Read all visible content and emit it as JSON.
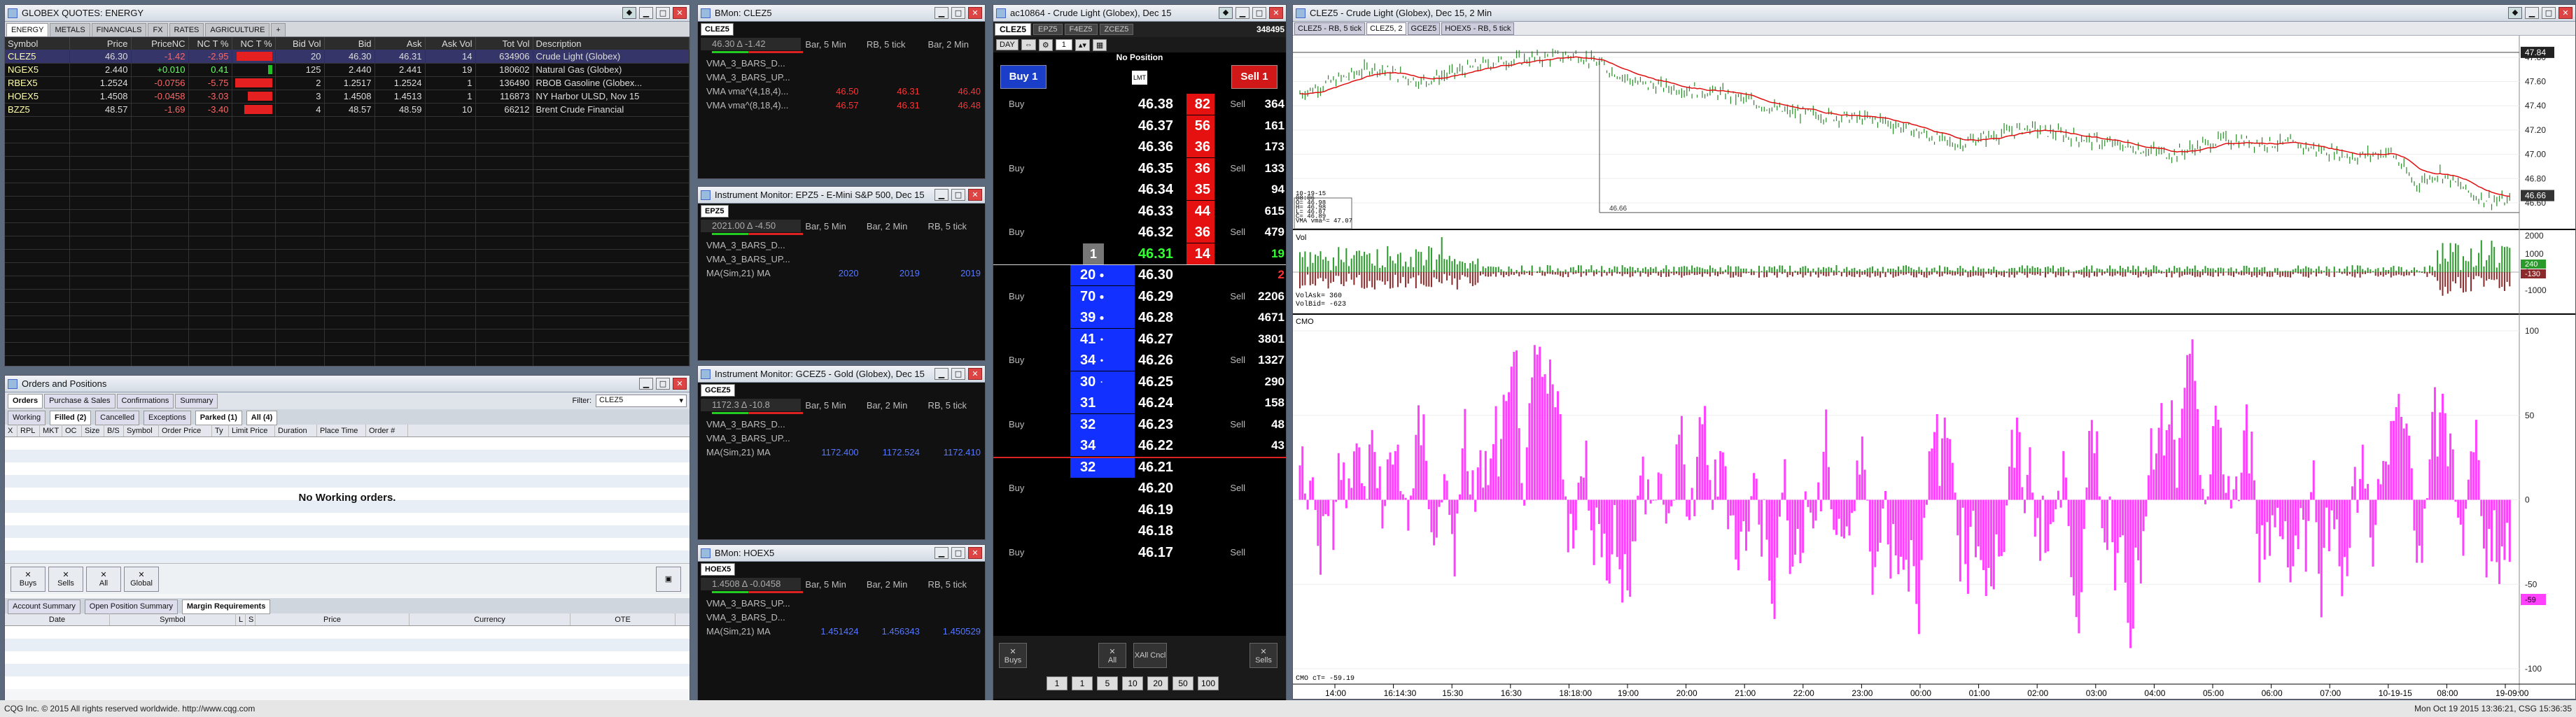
{
  "quotes": {
    "title": "GLOBEX QUOTES: ENERGY",
    "tabs": [
      "ENERGY",
      "METALS",
      "FINANCIALS",
      "FX",
      "RATES",
      "AGRICULTURE",
      "+"
    ],
    "columns": [
      "Symbol",
      "Price",
      "PriceNC",
      "NC T %",
      "NC T %",
      "Bid Vol",
      "Bid",
      "Ask",
      "Ask Vol",
      "Tot Vol",
      "Description"
    ],
    "rows": [
      {
        "sym": "CLEZ5",
        "price": "46.30",
        "nc": "-1.42",
        "pct": "-2.95",
        "bidvol": "20",
        "bid": "46.30",
        "ask": "46.31",
        "askvol": "14",
        "tot": "634906",
        "desc": "Crude Light (Globex)",
        "bar": 0.95,
        "dir": "neg"
      },
      {
        "sym": "NGEX5",
        "price": "2.440",
        "nc": "+0.010",
        "pct": "0.41",
        "bidvol": "125",
        "bid": "2.440",
        "ask": "2.441",
        "askvol": "19",
        "tot": "180602",
        "desc": "Natural Gas (Globex)",
        "bar": 0.1,
        "dir": "pos"
      },
      {
        "sym": "RBEX5",
        "price": "1.2524",
        "nc": "-0.0756",
        "pct": "-5.75",
        "bidvol": "2",
        "bid": "1.2517",
        "ask": "1.2524",
        "askvol": "1",
        "tot": "136490",
        "desc": "RBOB Gasoline (Globex...",
        "bar": 1.0,
        "dir": "neg"
      },
      {
        "sym": "HOEX5",
        "price": "1.4508",
        "nc": "-0.0458",
        "pct": "-3.03",
        "bidvol": "3",
        "bid": "1.4508",
        "ask": "1.4513",
        "askvol": "1",
        "tot": "116873",
        "desc": "NY Harbor ULSD, Nov 15",
        "bar": 0.65,
        "dir": "neg"
      },
      {
        "sym": "BZZ5",
        "price": "48.57",
        "nc": "-1.69",
        "pct": "-3.40",
        "bidvol": "4",
        "bid": "48.57",
        "ask": "48.59",
        "askvol": "10",
        "tot": "66212",
        "desc": "Brent Crude Financial",
        "bar": 0.75,
        "dir": "neg"
      }
    ]
  },
  "orders": {
    "title": "Orders and Positions",
    "tabs": [
      "Orders",
      "Purchase & Sales",
      "Confirmations",
      "Summary"
    ],
    "filter_label": "Filter:",
    "filter_value": "CLEZ5",
    "subtabs": [
      "Working",
      "Filled (2)",
      "Cancelled",
      "Exceptions",
      "Parked (1)",
      "All (4)"
    ],
    "columns": [
      "X",
      "RPL",
      "MKT",
      "OC",
      "Size",
      "B/S",
      "Symbol",
      "Order Price",
      "Ty",
      "Limit Price",
      "Duration",
      "Place Time",
      "Order #"
    ],
    "empty_text": "No Working orders.",
    "buttons": [
      "Buys",
      "Sells",
      "All",
      "Global"
    ],
    "bottom_tabs": [
      "Account Summary",
      "Open Position Summary",
      "Margin Requirements"
    ],
    "bottom_columns": [
      "Date",
      "Symbol",
      "L",
      "S",
      "Price",
      "Currency",
      "OTE"
    ]
  },
  "monitors": [
    {
      "title": "BMon: CLEZ5",
      "sym": "CLEZ5",
      "last": "46.30 Δ -1.42",
      "cols": [
        "Bar, 5 Min",
        "RB, 5 tick",
        "Bar, 2 Min"
      ],
      "rows": [
        {
          "label": "VMA_3_BARS_D...",
          "vals": [
            "",
            "",
            ""
          ]
        },
        {
          "label": "VMA_3_BARS_UP...",
          "vals": [
            "",
            "",
            ""
          ]
        },
        {
          "label": "VMA vma^(4,18,4)...",
          "vals": [
            "46.50",
            "46.31",
            "46.40"
          ],
          "color": "red"
        },
        {
          "label": "VMA vma^(8,18,4)...",
          "vals": [
            "46.57",
            "46.31",
            "46.48"
          ],
          "color": "red"
        }
      ]
    },
    {
      "title": "Instrument Monitor: EPZ5 - E-Mini S&P 500, Dec 15",
      "sym": "EPZ5",
      "last": "2021.00 Δ -4.50",
      "cols": [
        "Bar, 5 Min",
        "Bar, 2 Min",
        "RB, 5 tick"
      ],
      "rows": [
        {
          "label": "VMA_3_BARS_D...",
          "vals": [
            "",
            "",
            ""
          ]
        },
        {
          "label": "VMA_3_BARS_UP...",
          "vals": [
            "",
            "",
            ""
          ]
        },
        {
          "label": "MA(Sim,21) MA",
          "vals": [
            "2020",
            "2019",
            "2019"
          ],
          "color": "blue"
        }
      ]
    },
    {
      "title": "Instrument Monitor: GCEZ5 - Gold (Globex), Dec 15",
      "sym": "GCEZ5",
      "last": "1172.3 Δ -10.8",
      "cols": [
        "Bar, 5 Min",
        "Bar, 2 Min",
        "RB, 5 tick"
      ],
      "rows": [
        {
          "label": "VMA_3_BARS_D...",
          "vals": [
            "",
            "",
            ""
          ]
        },
        {
          "label": "VMA_3_BARS_UP...",
          "vals": [
            "",
            "",
            ""
          ]
        },
        {
          "label": "MA(Sim,21) MA",
          "vals": [
            "1172.400",
            "1172.524",
            "1172.410"
          ],
          "color": "blue"
        }
      ]
    },
    {
      "title": "BMon: HOEX5",
      "sym": "HOEX5",
      "last": "1.4508 Δ -0.0458",
      "cols": [
        "Bar, 5 Min",
        "Bar, 2 Min",
        "RB, 5 tick"
      ],
      "rows": [
        {
          "label": "VMA_3_BARS_UP...",
          "vals": [
            "",
            "",
            ""
          ]
        },
        {
          "label": "VMA_3_BARS_D...",
          "vals": [
            "",
            "",
            ""
          ]
        },
        {
          "label": "MA(Sim,21) MA",
          "vals": [
            "1.451424",
            "1.456343",
            "1.450529"
          ],
          "color": "blue"
        }
      ]
    }
  ],
  "dom": {
    "title": "ac10864 - Crude Light (Globex), Dec 15",
    "tabs": [
      "CLEZ5",
      "EPZ5",
      "F4EZ5",
      "ZCEZ5"
    ],
    "vol_total": "348495",
    "duration": "DAY",
    "qty": "1",
    "no_position": "No Position",
    "buy_label": "Buy 1",
    "sell_label": "Sell 1",
    "lmt": "LMT",
    "rows": [
      {
        "price": "46.38",
        "ask": "82",
        "vol": "364",
        "side": "ask"
      },
      {
        "price": "46.37",
        "ask": "56",
        "vol": "161",
        "side": "ask"
      },
      {
        "price": "46.36",
        "ask": "36",
        "vol": "173",
        "side": "ask"
      },
      {
        "price": "46.35",
        "ask": "36",
        "vol": "133",
        "side": "ask"
      },
      {
        "price": "46.34",
        "ask": "35",
        "vol": "94",
        "side": "ask"
      },
      {
        "price": "46.33",
        "ask": "44",
        "vol": "615",
        "side": "ask"
      },
      {
        "price": "46.32",
        "ask": "36",
        "vol": "479",
        "side": "ask"
      },
      {
        "price": "46.31",
        "ask": "14",
        "vol": "19",
        "side": "ask",
        "last": true,
        "lastsize": "1"
      },
      {
        "price": "46.30",
        "bid": "20",
        "vol": "2",
        "side": "bid",
        "dot": "●"
      },
      {
        "price": "46.29",
        "bid": "70",
        "vol": "2206",
        "side": "bid",
        "dot": "●"
      },
      {
        "price": "46.28",
        "bid": "39",
        "vol": "4671",
        "side": "bid",
        "dot": "●"
      },
      {
        "price": "46.27",
        "bid": "41",
        "vol": "3801",
        "side": "bid",
        "dot": "•"
      },
      {
        "price": "46.26",
        "bid": "34",
        "vol": "1327",
        "side": "bid",
        "dot": "•"
      },
      {
        "price": "46.25",
        "bid": "30",
        "vol": "290",
        "side": "bid",
        "dot": "·"
      },
      {
        "price": "46.24",
        "bid": "31",
        "vol": "158",
        "side": "bid"
      },
      {
        "price": "46.23",
        "bid": "32",
        "vol": "48",
        "side": "bid"
      },
      {
        "price": "46.22",
        "bid": "34",
        "vol": "43",
        "side": "bid"
      },
      {
        "price": "46.21",
        "bid": "32",
        "vol": "",
        "side": "bid"
      },
      {
        "price": "46.20",
        "vol": "",
        "side": "none"
      },
      {
        "price": "46.19",
        "vol": "",
        "side": "none"
      },
      {
        "price": "46.18",
        "vol": "",
        "side": "none"
      },
      {
        "price": "46.17",
        "vol": "",
        "side": "none"
      }
    ],
    "buy_text": "Buy",
    "sell_text": "Sell",
    "bottom_buttons": [
      "Buys",
      "All",
      "XAll Cncl",
      "Sells"
    ],
    "qty_buttons": [
      "1",
      "1",
      "5",
      "10",
      "20",
      "50",
      "100"
    ]
  },
  "chart": {
    "title": "CLEZ5 - Crude Light (Globex), Dec 15, 2 Min",
    "tabs": [
      "CLEZ5 - RB, 5 tick",
      "CLEZ5, 2",
      "GCEZ5",
      "HOEX5 - RB, 5 tick"
    ],
    "price_labels": [
      "47.80",
      "47.60",
      "47.40",
      "47.20",
      "47.00",
      "46.80",
      "46.60"
    ],
    "last_price": "46.66",
    "marker_price": "47.84",
    "line_label": "46.66",
    "info_lines": [
      "10-19-15",
      "08:06",
      "O=    46.98",
      "H=    46.98",
      "L=    46.87",
      "C=    46.89",
      "VMA vma^=  47.07"
    ],
    "vol_label": "Vol",
    "vol_axis": [
      "2000",
      "1000",
      "0",
      "-1000"
    ],
    "vol_readout": [
      "VolAsk=      360",
      "VolBid=     -623"
    ],
    "vol_tags": [
      "240",
      "-130"
    ],
    "cmo_label": "CMO",
    "cmo_axis": [
      "100",
      "50",
      "0",
      "-50",
      "-100"
    ],
    "cmo_readout": "CMO cT=    -59.19",
    "cmo_tag": "-59",
    "time_labels": [
      "14:00",
      "16:14:30",
      "15:30",
      "16:30",
      "18:18:00",
      "19:00",
      "20:00",
      "21:00",
      "22:00",
      "23:00",
      "00:00",
      "01:00",
      "02:00",
      "03:00",
      "04:00",
      "05:00",
      "06:00",
      "07:00",
      "10-19-15",
      "08:00",
      "19-09:00"
    ]
  },
  "status_left": "CQG Inc. © 2015 All rights reserved worldwide. http://www.cqg.com",
  "status_right": "Mon Oct 19 2015 13:36:21, CSG 15:36:35",
  "colors": {
    "bid": "#1230ff",
    "ask": "#e51010",
    "cmo": "#ff40ff",
    "vol_up": "#2a9a2a",
    "vol_dn": "#8a2a2a",
    "price": "#2a8a2a",
    "ma": "#e01010"
  }
}
